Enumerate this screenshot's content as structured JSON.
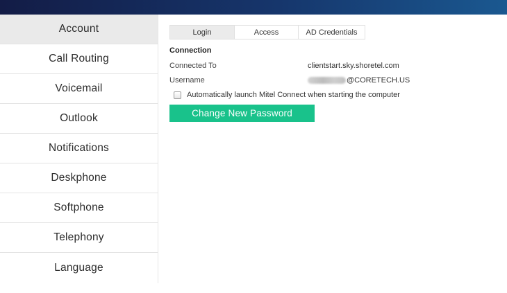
{
  "sidebar": {
    "items": [
      {
        "label": "Account",
        "active": true
      },
      {
        "label": "Call Routing"
      },
      {
        "label": "Voicemail"
      },
      {
        "label": "Outlook"
      },
      {
        "label": "Notifications"
      },
      {
        "label": "Deskphone"
      },
      {
        "label": "Softphone"
      },
      {
        "label": "Telephony"
      },
      {
        "label": "Language"
      }
    ]
  },
  "tabs": [
    {
      "label": "Login",
      "active": true
    },
    {
      "label": "Access"
    },
    {
      "label": "AD Credentials"
    }
  ],
  "connection": {
    "title": "Connection",
    "connected_to_label": "Connected To",
    "connected_to_value": "clientstart.sky.shoretel.com",
    "username_label": "Username",
    "username_domain": "@CORETECH.US"
  },
  "auto_launch": {
    "label": "Automatically launch Mitel Connect when starting the computer",
    "checked": false
  },
  "actions": {
    "change_password_label": "Change New Password"
  },
  "colors": {
    "accent": "#19c28b",
    "header_dark": "#131c46",
    "header_light": "#1a5890"
  }
}
